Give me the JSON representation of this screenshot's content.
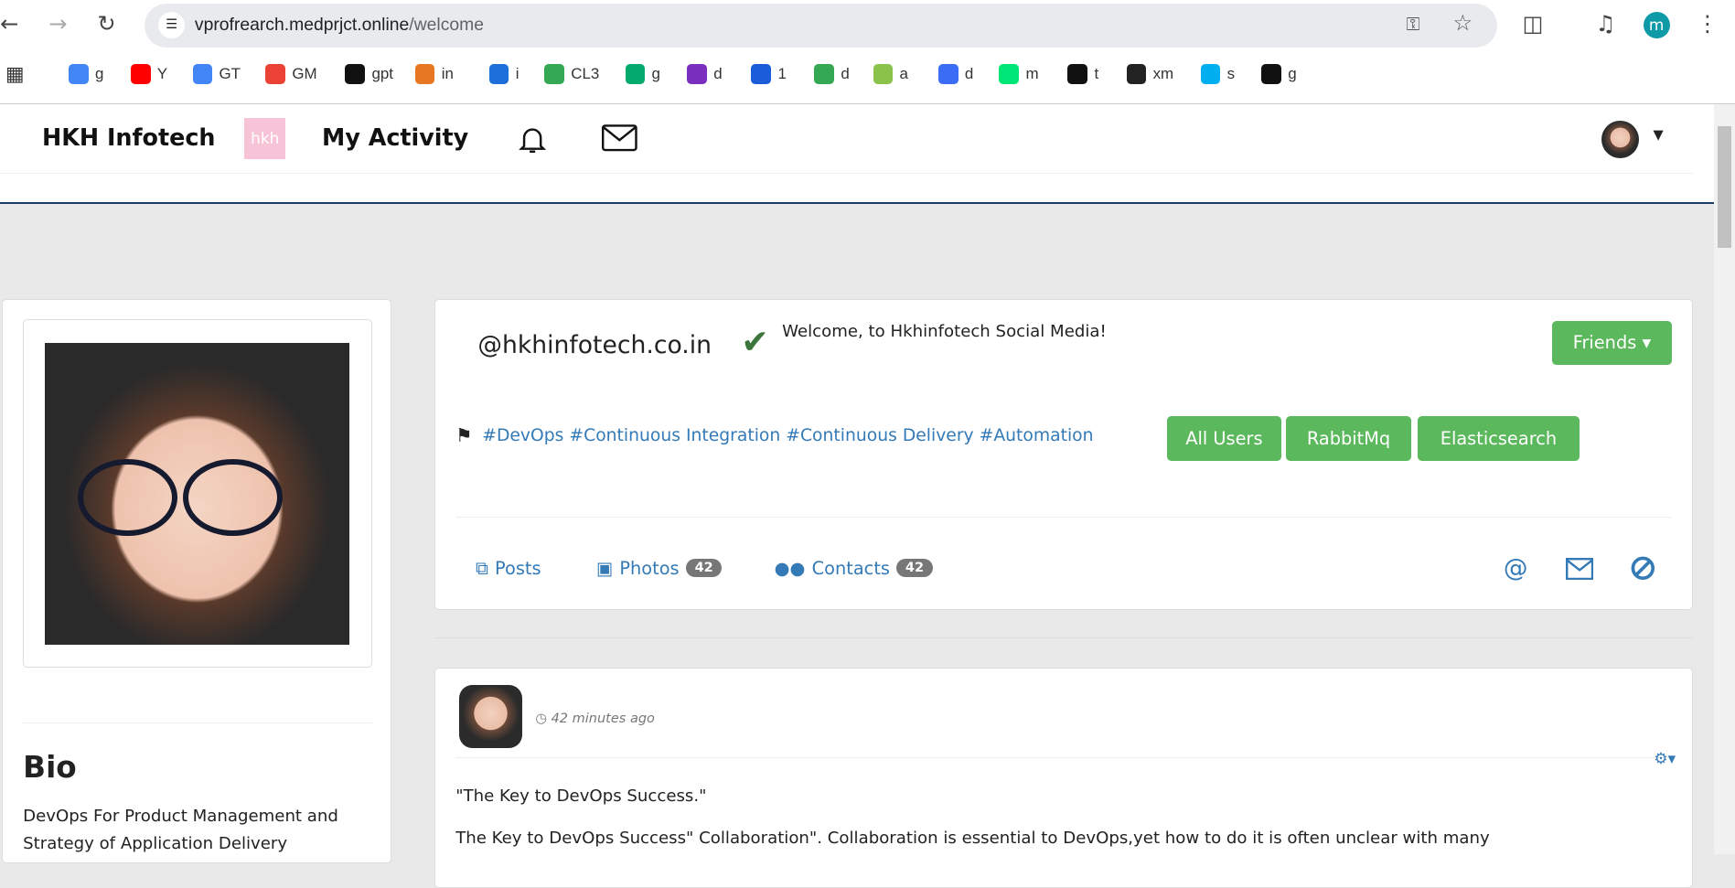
{
  "browser": {
    "url_host": "vprofrearch.medprjct.online",
    "url_path": "/welcome",
    "profile_initial": "m",
    "bookmarks": [
      {
        "label": "g",
        "color": "#4285f4"
      },
      {
        "label": "Y",
        "color": "#ff0000"
      },
      {
        "label": "GT",
        "color": "#4285f4"
      },
      {
        "label": "GM",
        "color": "#ea4335"
      },
      {
        "label": "gpt",
        "color": "#111111"
      },
      {
        "label": "in",
        "color": "#e87722"
      },
      {
        "label": "i",
        "color": "#1e6fd9"
      },
      {
        "label": "CL3",
        "color": "#34a853"
      },
      {
        "label": "g",
        "color": "#04aa6d"
      },
      {
        "label": "d",
        "color": "#7b2fbe"
      },
      {
        "label": "1",
        "color": "#1a5dd8"
      },
      {
        "label": "d",
        "color": "#34a853"
      },
      {
        "label": "a",
        "color": "#8bc34a"
      },
      {
        "label": "d",
        "color": "#3b6cf6"
      },
      {
        "label": "m",
        "color": "#00e676"
      },
      {
        "label": "t",
        "color": "#111111"
      },
      {
        "label": "xm",
        "color": "#222222"
      },
      {
        "label": "s",
        "color": "#00aff0"
      },
      {
        "label": "g",
        "color": "#111111"
      }
    ]
  },
  "nav": {
    "brand": "HKH Infotech",
    "logo_text": "hkh",
    "my_activity": "My Activity"
  },
  "profile": {
    "handle": "@hkhinfotech.co.in",
    "welcome": "Welcome, to Hkhinfotech Social Media!",
    "friends_label": "Friends",
    "tags": "#DevOps #Continuous Integration #Continuous Delivery #Automation",
    "buttons": [
      "All Users",
      "RabbitMq",
      "Elasticsearch"
    ],
    "tabs": {
      "posts": "Posts",
      "photos": "Photos",
      "photos_count": "42",
      "contacts": "Contacts",
      "contacts_count": "42"
    }
  },
  "bio": {
    "title": "Bio",
    "text": "DevOps For Product Management and Strategy of Application Delivery"
  },
  "post": {
    "time": "42 minutes ago",
    "title": "\"The Key to DevOps Success.\"",
    "body": "The Key to DevOps Success\" Collaboration\". Collaboration is essential to DevOps,yet how to do it is often unclear with many"
  },
  "colors": {
    "accent": "#337ab7",
    "success": "#5cb85c",
    "navline": "#1d3a6b"
  }
}
